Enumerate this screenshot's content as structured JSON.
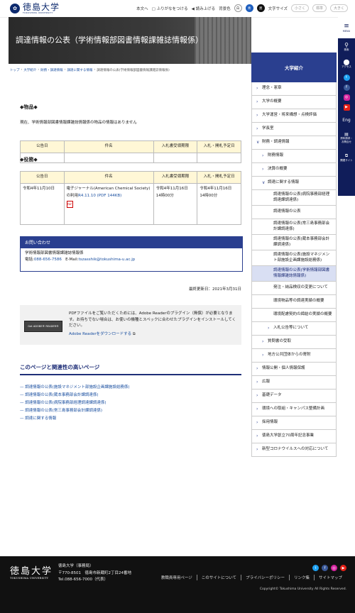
{
  "header": {
    "logo_jp": "徳島大学",
    "logo_en": "TOKUSHIMA UNIVERSITY",
    "util": {
      "honbun": "本文へ",
      "furigana": "ふりがなをつける",
      "yomiage": "読み上げる",
      "haikei": "背景色",
      "bg_white": "白",
      "bg_blue": "青",
      "bg_black": "黒",
      "moji": "文字サイズ",
      "small": "小さく",
      "std": "標準",
      "large": "大きく"
    }
  },
  "rail": {
    "menu": "MENU",
    "search": "検索",
    "access": "アクセス",
    "lang": "Eng",
    "shiryo": "資料請求・お問合せ",
    "related": "関連サイト"
  },
  "hero": {
    "title": "調達情報の公表（学術情報部図書情報課雑誌情報係）"
  },
  "breadcrumb": [
    "トップ",
    "大学紹介",
    "財務・調達情報",
    "調達に関する情報",
    "調達情報の公表(学術情報部図書情報課雑誌情報係)"
  ],
  "goods": {
    "heading": "◆物品◆",
    "note": "現在、学術情報部図書情報課雑誌情報係の物品の情報はありません",
    "headers": [
      "公告日",
      "件名",
      "入札書受領期限",
      "入札・開札予定日"
    ]
  },
  "services": {
    "heading": "◆役務◆",
    "headers": [
      "公告日",
      "件名",
      "入札書受領期限",
      "入札・開札予定日"
    ],
    "row": {
      "date": "令和4年11月10日",
      "subject": "電子ジャーナル(American Chemical Society)の利用",
      "link": "R4.11.10 (PDF 144KB)",
      "deadline1": "令和4年11月16日",
      "deadline2": "14時00分",
      "open1": "令和4年11月16日",
      "open2": "14時00分"
    }
  },
  "contact": {
    "title": "お問い合わせ",
    "org": "学術情報部図書情報課雑誌情報係",
    "tel_label": "電話:",
    "tel": "088-656-7586",
    "email_label": "E-Mail:",
    "email": "tszasshik@tokushima-u.ac.jp"
  },
  "updated": "最終更新日：2021年3月31日",
  "pdf": {
    "badge": "Get ADOBE® READER®",
    "text": "PDFファイルをご覧いただくためには、Adobe Readerのプラグイン（無償）が必要となります。お持ちでない場合は、お使いの機種とスペックに合わせたプラグインをインストールしてください。",
    "link": "Adobe Readerをダウンロードする"
  },
  "related": {
    "title": "このページと関連性の高いページ",
    "items": [
      "調達情報の公表(施設マネジメント部施設企画課施設総務係)",
      "調達情報の公表(蔵本事務部会計課調達係)",
      "調達情報の公表(病院事務部経理調達課調達係)",
      "調達情報の公表(常三島事務部会計課調達係)",
      "調達に関する情報"
    ]
  },
  "sidebar": {
    "head": "大学紹介",
    "items": [
      {
        "label": "理念・憲章",
        "level": 1,
        "arrow": "›"
      },
      {
        "label": "大学の概要",
        "level": 1,
        "arrow": "›"
      },
      {
        "label": "大学運営・将来構想・点検評価",
        "level": 1,
        "arrow": "›"
      },
      {
        "label": "学長室",
        "level": 1,
        "arrow": "›"
      },
      {
        "label": "財務・調達情報",
        "level": 1,
        "arrow": "∨"
      },
      {
        "label": "財務情報",
        "level": 2,
        "arrow": "›"
      },
      {
        "label": "決算の概要",
        "level": 2,
        "arrow": "›"
      },
      {
        "label": "調達に関する情報",
        "level": 2,
        "arrow": "∨"
      },
      {
        "label": "調達情報の公表(病院事務部経理調達課調達係)",
        "level": 3,
        "arrow": ""
      },
      {
        "label": "調達情報の公表",
        "level": 3,
        "arrow": ""
      },
      {
        "label": "調達情報の公表(常三島事務部会計課調達係)",
        "level": 3,
        "arrow": ""
      },
      {
        "label": "調達情報の公表(蔵本事務部会計課調達係)",
        "level": 3,
        "arrow": ""
      },
      {
        "label": "調達情報の公表(施設マネジメント部施設企画課施設総務係)",
        "level": 3,
        "arrow": ""
      },
      {
        "label": "調達情報の公表(学術情報部図書情報課雑誌情報係)",
        "level": 3,
        "arrow": "",
        "active": true
      },
      {
        "label": "発注・納品検収の変更について",
        "level": 3,
        "arrow": ""
      },
      {
        "label": "環境物品等の調達実績の概要",
        "level": 3,
        "arrow": ""
      },
      {
        "label": "環境配慮契約の締結の実績の概要",
        "level": 3,
        "arrow": ""
      },
      {
        "label": "入札公告等について",
        "level": 3,
        "arrow": "›"
      },
      {
        "label": "質問書の受取",
        "level": 2,
        "arrow": "›"
      },
      {
        "label": "地方公共団体からの寄附",
        "level": 2,
        "arrow": "›"
      },
      {
        "label": "情報公開・個人情報保護",
        "level": 1,
        "arrow": "›"
      },
      {
        "label": "広報",
        "level": 1,
        "arrow": "›"
      },
      {
        "label": "基礎データ",
        "level": 1,
        "arrow": "›"
      },
      {
        "label": "環境への取組・キャンパス整備計画",
        "level": 1,
        "arrow": "›"
      },
      {
        "label": "採用情報",
        "level": 1,
        "arrow": "›"
      },
      {
        "label": "徳島大学創立70周年記念事業",
        "level": 1,
        "arrow": "›"
      },
      {
        "label": "新型コロナウイルスへの対応について",
        "level": 1,
        "arrow": "›"
      }
    ]
  },
  "footer": {
    "logo_jp": "徳島大学",
    "logo_en": "TOKUSHIMA UNIVERSITY",
    "addr1": "徳島大学（事務局）",
    "addr2": "〒770-8501　徳島市新蔵町2丁目24番地",
    "addr3": "Tel.088-656-7000（代表）",
    "links": [
      "教職員専用ページ",
      "このサイトについて",
      "プライバシーポリシー",
      "リンク集",
      "サイトマップ"
    ],
    "copy": "Copyright© Tokushima University All Rights Reserved."
  }
}
